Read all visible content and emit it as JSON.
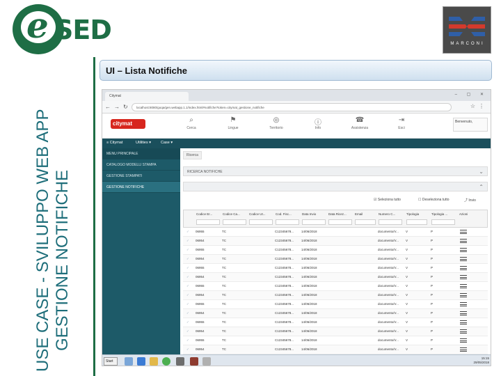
{
  "slide": {
    "vertical_title_line1": "USE CASE - SVILUPPO WEB APP",
    "vertical_title_line2": "GESTIONE NOTIFICHE",
    "header_title": "UI – Lista Notifiche",
    "logo_text": "SED",
    "logo_letter": "e",
    "istit_text": "MARCONI",
    "accent_green": "#1e6e45"
  },
  "browser": {
    "tab_label": "Citymat",
    "url": "localhost:8080/goqa/gen.webapp.1.1/index.html#notifiche?token=citymat_gestione_notifiche",
    "nav_icons": [
      "back-icon",
      "forward-icon",
      "reload-icon"
    ]
  },
  "app": {
    "brand": "citymat",
    "toolbar": [
      {
        "icon": "search-icon",
        "glyph": "⌕",
        "label": "Cerca"
      },
      {
        "icon": "flag-icon",
        "glyph": "⚑",
        "label": "Lingue"
      },
      {
        "icon": "globe-icon",
        "glyph": "◎",
        "label": "Territorio"
      },
      {
        "icon": "info-icon",
        "glyph": "ⓘ",
        "label": "Info"
      },
      {
        "icon": "help-icon",
        "glyph": "☎",
        "label": "Assistenza"
      },
      {
        "icon": "exit-icon",
        "glyph": "⇥",
        "label": "Esci"
      }
    ],
    "welcome_label": "Benvenuto,",
    "menu": [
      "≡ Citymat",
      "Utilities ▾",
      "Case ▾"
    ],
    "sidebar": [
      {
        "label": "MENU PRINCIPALE",
        "kind": "head"
      },
      {
        "label": "CATALOGO MODELLI STAMPA",
        "kind": "item"
      },
      {
        "label": "GESTIONE STAMPATI",
        "kind": "item"
      },
      {
        "label": "GESTIONE NOTIFICHE",
        "kind": "active"
      }
    ],
    "breadcrumb": "Ricerca",
    "section_search": "RICERCA NOTIFICHE",
    "section_results": "",
    "actions": {
      "select_all": "Seleziona tutto",
      "deselect_all": "Deseleziona tutto",
      "delete": "Invio"
    },
    "columns": [
      "Codice Er...",
      "Codice Ca...",
      "Codice Ut...",
      "Cod. Fisc...",
      "Data Invio",
      "Data Ricez...",
      "Email",
      "Numero C...",
      "Tipologia",
      "Tipologia ...",
      "Azioni"
    ],
    "rows": [
      [
        "06955",
        "TC",
        "",
        "C12345678...",
        "14/06/2018",
        "",
        "",
        "documento/V...",
        "V",
        "P"
      ],
      [
        "06954",
        "TC",
        "",
        "C12345678...",
        "14/06/2018",
        "",
        "",
        "documento/V...",
        "V",
        "P"
      ],
      [
        "06955",
        "TC",
        "",
        "C12345678...",
        "14/06/2018",
        "",
        "",
        "documento/V...",
        "V",
        "P"
      ],
      [
        "06954",
        "TC",
        "",
        "C12345678...",
        "14/06/2018",
        "",
        "",
        "documento/V...",
        "V",
        "P"
      ],
      [
        "06955",
        "TC",
        "",
        "C12345678...",
        "14/06/2018",
        "",
        "",
        "documento/V...",
        "V",
        "P"
      ],
      [
        "06954",
        "TC",
        "",
        "C12345678...",
        "14/06/2018",
        "",
        "",
        "documento/V...",
        "V",
        "P"
      ],
      [
        "06955",
        "TC",
        "",
        "C12345678...",
        "14/06/2018",
        "",
        "",
        "documento/V...",
        "V",
        "P"
      ],
      [
        "06954",
        "TC",
        "",
        "C12345678...",
        "14/06/2018",
        "",
        "",
        "documento/V...",
        "V",
        "P"
      ],
      [
        "06955",
        "TC",
        "",
        "C12345678...",
        "14/06/2018",
        "",
        "",
        "documento/V...",
        "V",
        "P"
      ],
      [
        "06954",
        "TC",
        "",
        "C12345678...",
        "14/06/2018",
        "",
        "",
        "documento/V...",
        "V",
        "P"
      ],
      [
        "06955",
        "TC",
        "",
        "C12345678...",
        "14/06/2018",
        "",
        "",
        "documento/V...",
        "V",
        "P"
      ],
      [
        "06954",
        "TC",
        "",
        "C12345678...",
        "14/06/2018",
        "",
        "",
        "documento/V...",
        "V",
        "P"
      ],
      [
        "06955",
        "TC",
        "",
        "C12345678...",
        "14/06/2018",
        "",
        "",
        "documento/V...",
        "V",
        "P"
      ],
      [
        "06954",
        "TC",
        "",
        "C12345678...",
        "14/06/2018",
        "",
        "",
        "documento/V...",
        "V",
        "P"
      ]
    ]
  },
  "taskbar": {
    "start": "Start",
    "clock_time": "15:15",
    "clock_date": "29/05/2018",
    "icons": [
      "explorer-icon",
      "media-icon",
      "folder-icon",
      "chrome-icon",
      "mail-icon",
      "app-icon",
      "tool-icon"
    ]
  }
}
